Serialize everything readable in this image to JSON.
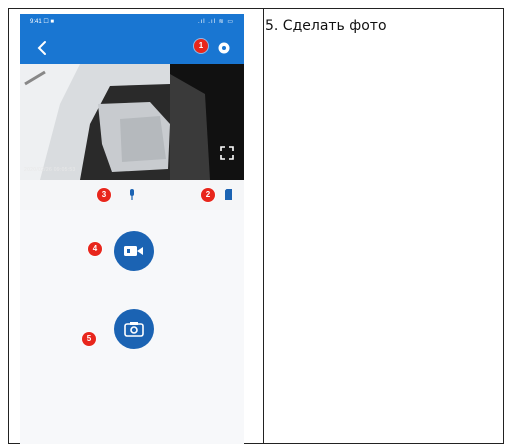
{
  "caption": "5. Сделать фото",
  "phone": {
    "status_time": "9:41 ☐ ■",
    "status_icons": ".ıl .ıl ≋ ▭",
    "video_timestamp": "2020/02/26 09:05:53",
    "markers": [
      "1",
      "2",
      "3",
      "4",
      "5"
    ]
  },
  "colors": {
    "app_bar": "#1976d2",
    "action_button": "#1b63b3",
    "marker": "#e8261c"
  },
  "icons": [
    "back-icon",
    "settings-icon",
    "fullscreen-icon",
    "microphone-icon",
    "sd-card-icon",
    "video-camera-icon",
    "camera-icon"
  ]
}
